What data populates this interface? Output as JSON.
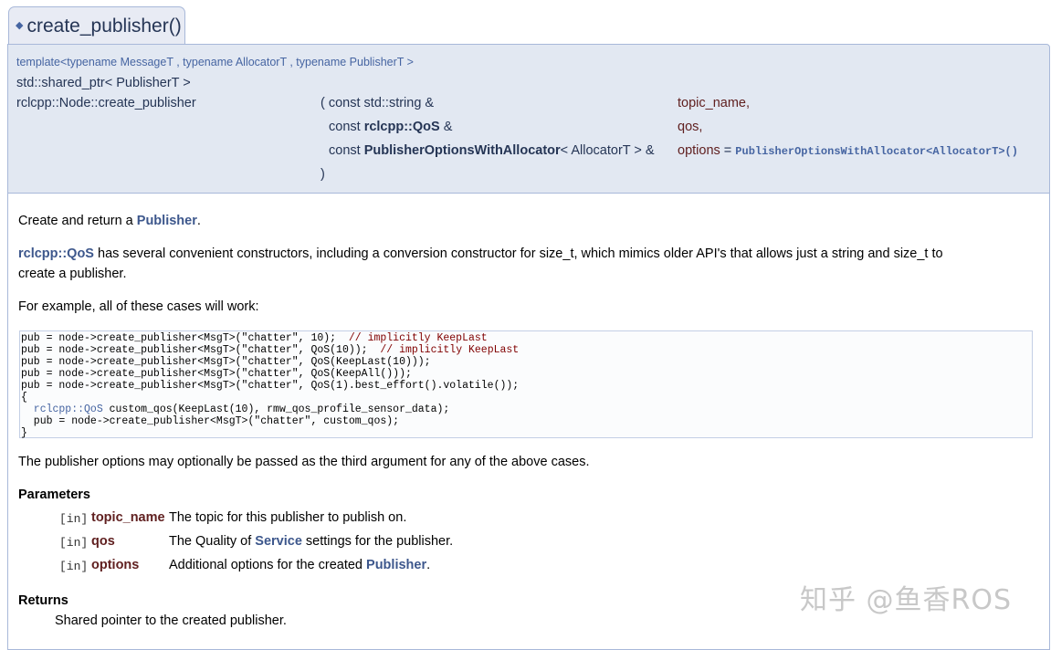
{
  "member": {
    "tab_title": "create_publisher()",
    "template_line": "template<typename MessageT , typename AllocatorT , typename PublisherT >",
    "return_type": "std::shared_ptr< PublisherT >",
    "function_name": "rclcpp::Node::create_publisher",
    "params": [
      {
        "prefix": "( const std::string &",
        "bold": "",
        "suffix": "",
        "name": "topic_name,",
        "default": ""
      },
      {
        "prefix": "const ",
        "bold": "rclcpp::QoS",
        "suffix": " &",
        "name": "qos,",
        "default": ""
      },
      {
        "prefix": "const ",
        "bold": "PublisherOptionsWithAllocator",
        "suffix": "< AllocatorT > &",
        "name": "options",
        "default": "PublisherOptionsWithAllocator<AllocatorT>()"
      }
    ],
    "default_sep": " = ",
    "close_paren": ")"
  },
  "doc": {
    "intro_prefix": "Create and return a ",
    "intro_link": "Publisher",
    "intro_suffix": ".",
    "qos_para": {
      "link": "rclcpp::QoS",
      "line1_rest": " has several convenient constructors, including a conversion constructor for size_t, which mimics older API's that allows just a string and size_t to",
      "line2": "create a publisher."
    },
    "example_intro": "For example, all of these cases will work:",
    "code_lines": [
      {
        "code": "pub = node->create_publisher<MsgT>(\"chatter\", 10);  ",
        "comment": "// implicitly KeepLast"
      },
      {
        "code": "pub = node->create_publisher<MsgT>(\"chatter\", QoS(10));  ",
        "comment": "// implicitly KeepLast"
      },
      {
        "code": "pub = node->create_publisher<MsgT>(\"chatter\", QoS(KeepLast(10)));",
        "comment": ""
      },
      {
        "code": "pub = node->create_publisher<MsgT>(\"chatter\", QoS(KeepAll()));",
        "comment": ""
      },
      {
        "code": "pub = node->create_publisher<MsgT>(\"chatter\", QoS(1).best_effort().volatile());",
        "comment": ""
      },
      {
        "code": "{",
        "comment": ""
      },
      {
        "type": "  rclcpp::QoS",
        "code": " custom_qos(KeepLast(10), rmw_qos_profile_sensor_data);",
        "comment": ""
      },
      {
        "code": "  pub = node->create_publisher<MsgT>(\"chatter\", custom_qos);",
        "comment": ""
      },
      {
        "code": "}",
        "comment": ""
      }
    ],
    "options_para": "The publisher options may optionally be passed as the third argument for any of the above cases.",
    "parameters_heading": "Parameters",
    "parameters": [
      {
        "dir": "[in]",
        "name": "topic_name",
        "desc_prefix": "The topic for this publisher to publish on.",
        "desc_link": "",
        "desc_suffix": ""
      },
      {
        "dir": "[in]",
        "name": "qos",
        "desc_prefix": "The Quality of ",
        "desc_link": "Service",
        "desc_suffix": " settings for the publisher."
      },
      {
        "dir": "[in]",
        "name": "options",
        "desc_prefix": "Additional options for the created ",
        "desc_link": "Publisher",
        "desc_suffix": "."
      }
    ],
    "returns_heading": "Returns",
    "returns_text": "Shared pointer to the created publisher."
  },
  "watermark": "知乎 @鱼香ROS"
}
